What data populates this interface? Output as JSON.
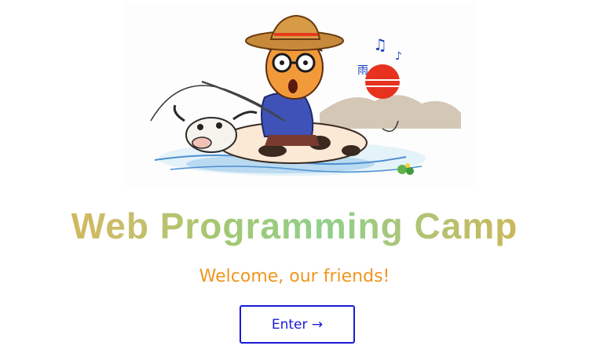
{
  "hero": {
    "image_name": "cartoon-boy-riding-cow-illustration"
  },
  "title": "Web Programming Camp",
  "subtitle": "Welcome, our friends!",
  "enter_button": {
    "label": "Enter →"
  },
  "colors": {
    "title_gradient_start": "#d4b24a",
    "title_gradient_mid": "#8fd08a",
    "title_gradient_end": "#dbae44",
    "subtitle": "#f0951e",
    "button_border": "#1a1ad8",
    "button_text": "#1a1ad8",
    "background": "#ffffff"
  }
}
